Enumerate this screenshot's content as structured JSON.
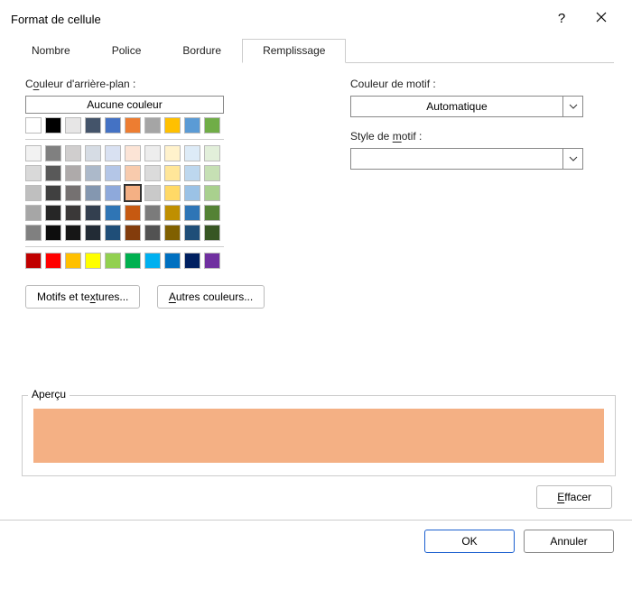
{
  "title": "Format de cellule",
  "tabs": [
    "Nombre",
    "Police",
    "Bordure",
    "Remplissage"
  ],
  "active_tab": 3,
  "left": {
    "bg_label_pre": "C",
    "bg_label_u": "o",
    "bg_label_post": "uleur d'arrière-plan :",
    "no_color": "Aucune couleur",
    "row0": [
      "#ffffff",
      "#000000",
      "#e7e6e6",
      "#44546a",
      "#4472c4",
      "#ed7d31",
      "#a5a5a5",
      "#ffc000",
      "#5b9bd5",
      "#70ad47"
    ],
    "shade_rows": [
      [
        "#f2f2f2",
        "#808080",
        "#d0cece",
        "#d6dce4",
        "#d9e1f2",
        "#fce4d6",
        "#ededed",
        "#fff2cc",
        "#ddebf7",
        "#e2efda"
      ],
      [
        "#d9d9d9",
        "#595959",
        "#aeaaaa",
        "#acb9ca",
        "#b4c6e7",
        "#f8cbad",
        "#dbdbdb",
        "#ffe699",
        "#bdd7ee",
        "#c6e0b4"
      ],
      [
        "#bfbfbf",
        "#404040",
        "#757171",
        "#8497b0",
        "#8ea9db",
        "#f4b084",
        "#c9c9c9",
        "#ffd966",
        "#9bc2e6",
        "#a9d08e"
      ],
      [
        "#a6a6a6",
        "#262626",
        "#3a3838",
        "#333f4f",
        "#2f75b5",
        "#c65911",
        "#7b7b7b",
        "#bf8f00",
        "#2e75b6",
        "#548235"
      ],
      [
        "#808080",
        "#0d0d0d",
        "#161616",
        "#222b35",
        "#1f4e78",
        "#833c0c",
        "#525252",
        "#806000",
        "#1f4e78",
        "#375623"
      ]
    ],
    "std_row": [
      "#c00000",
      "#ff0000",
      "#ffc000",
      "#ffff00",
      "#92d050",
      "#00b050",
      "#00b0f0",
      "#0070c0",
      "#002060",
      "#7030a0"
    ],
    "selected": {
      "row": 2,
      "col": 5
    },
    "fill_effects_pre": "Motifs et te",
    "fill_effects_u": "x",
    "fill_effects_post": "tures...",
    "more_colors_u": "A",
    "more_colors_post": "utres couleurs...",
    "preview_color": "#f4b084"
  },
  "right": {
    "pattern_color_label": "Couleur de motif :",
    "pattern_color_value": "Automatique",
    "pattern_style_pre": "Style de ",
    "pattern_style_u": "m",
    "pattern_style_post": "otif :",
    "pattern_style_value": ""
  },
  "preview_label": "Aperçu",
  "clear_u": "E",
  "clear_post": "ffacer",
  "ok": "OK",
  "cancel": "Annuler"
}
